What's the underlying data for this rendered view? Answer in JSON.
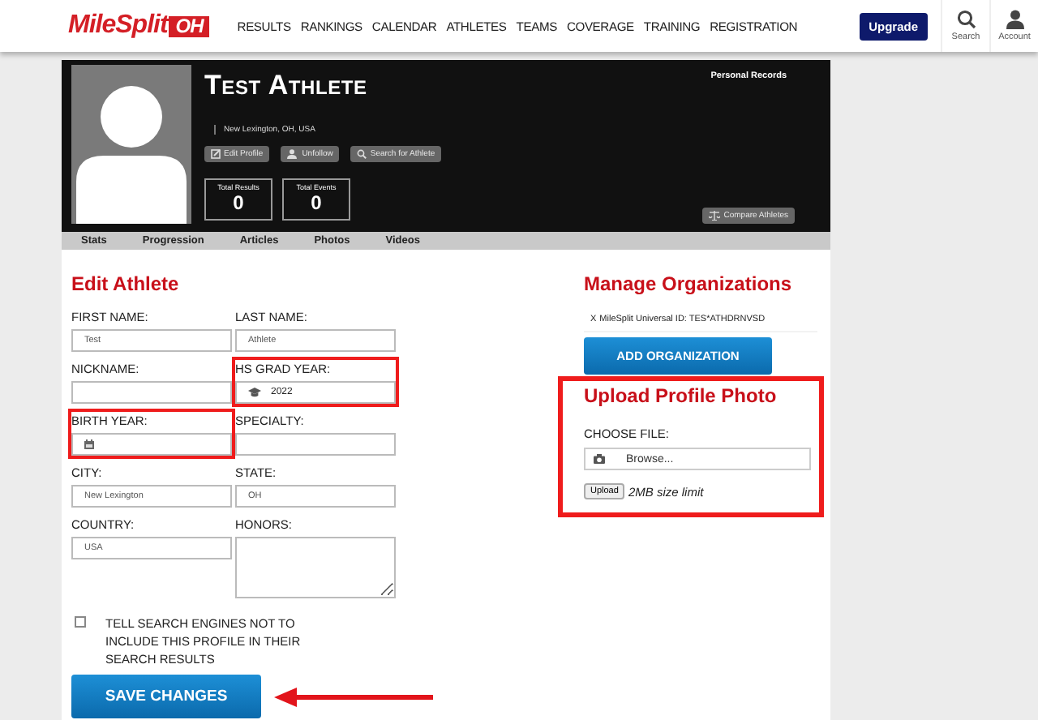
{
  "header": {
    "logo": {
      "name": "MileSplit",
      "region": "OH"
    },
    "nav": [
      "RESULTS",
      "RANKINGS",
      "CALENDAR",
      "ATHLETES",
      "TEAMS",
      "COVERAGE",
      "TRAINING",
      "REGISTRATION"
    ],
    "upgrade": "Upgrade",
    "search": "Search",
    "account": "Account"
  },
  "profile": {
    "name": "Test Athlete",
    "location": "New Lexington, OH, USA",
    "actions": [
      {
        "kind": "edit",
        "label": "Edit Profile"
      },
      {
        "kind": "unfollow",
        "label": "Unfollow"
      },
      {
        "kind": "search",
        "label": "Search for Athlete"
      }
    ],
    "stats": [
      {
        "label": "Total Results",
        "value": "0"
      },
      {
        "label": "Total Events",
        "value": "0"
      }
    ],
    "records_title": "Personal Records",
    "compare": "Compare Athletes"
  },
  "tabs": [
    {
      "label": "Stats",
      "selected": false
    },
    {
      "label": "Progression",
      "selected": false
    },
    {
      "label": "Articles",
      "selected": false
    },
    {
      "label": "Photos",
      "selected": false
    },
    {
      "label": "Videos",
      "selected": false
    }
  ],
  "edit": {
    "title": "Edit Athlete",
    "fields": [
      {
        "label": "FIRST NAME:",
        "value": "Test",
        "kind": "text",
        "highlighted": false
      },
      {
        "label": "LAST NAME:",
        "value": "Athlete",
        "kind": "text",
        "highlighted": false
      },
      {
        "label": "NICKNAME:",
        "kind": "text",
        "highlighted": false
      },
      {
        "label": "HS GRAD YEAR:",
        "value": "2022",
        "kind": "grad",
        "highlighted": true
      },
      {
        "label": "BIRTH YEAR:",
        "kind": "date",
        "highlighted": true
      },
      {
        "label": "SPECIALTY:",
        "kind": "text",
        "highlighted": false
      },
      {
        "label": "CITY:",
        "value": "New Lexington",
        "kind": "text",
        "highlighted": false
      },
      {
        "label": "STATE:",
        "value": "OH",
        "kind": "text",
        "highlighted": false
      },
      {
        "label": "COUNTRY:",
        "value": "USA",
        "kind": "text",
        "highlighted": false
      },
      {
        "label": "HONORS:",
        "kind": "textarea",
        "highlighted": false
      }
    ],
    "noindex": {
      "label": "TELL SEARCH ENGINES NOT TO INCLUDE THIS PROFILE IN THEIR SEARCH RESULTS",
      "checked": false
    },
    "save": "SAVE CHANGES",
    "save_arrow": true
  },
  "organizations": {
    "title": "Manage Organizations",
    "items": [
      {
        "remove": "X",
        "text": "MileSplit Universal ID: TES*ATHDRNVSD"
      }
    ],
    "add": "ADD ORGANIZATION"
  },
  "upload": {
    "title": "Upload Profile Photo",
    "highlighted": true,
    "choose_label": "CHOOSE FILE:",
    "browse": "Browse...",
    "button": "Upload",
    "note": "2MB size limit"
  }
}
